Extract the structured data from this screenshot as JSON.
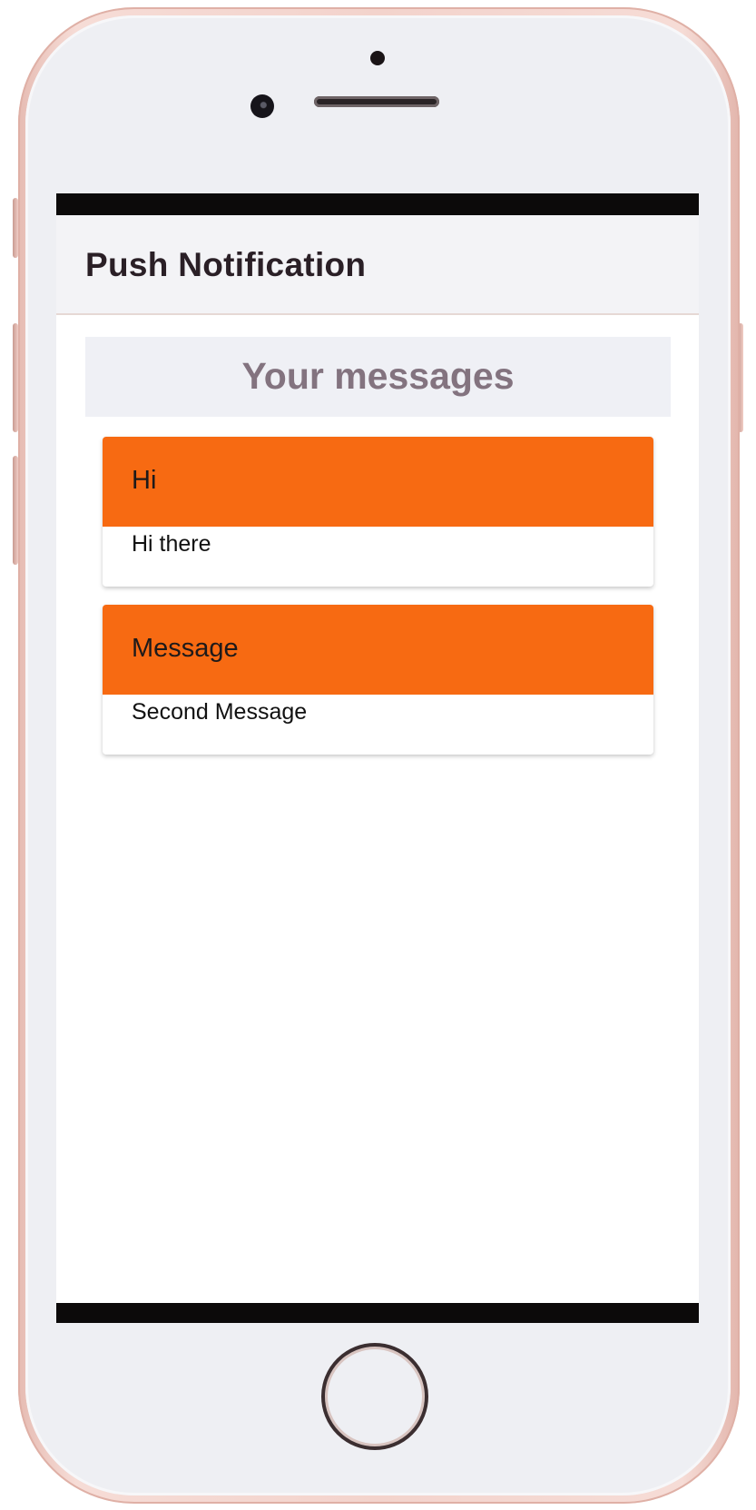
{
  "app": {
    "title": "Push Notification"
  },
  "main": {
    "heading": "Your messages",
    "messages": [
      {
        "title": "Hi",
        "body": "Hi there"
      },
      {
        "title": "Message",
        "body": "Second Message"
      }
    ]
  },
  "colors": {
    "card_header": "#f76a12",
    "heading_text": "#83737f",
    "app_bar": "#f3f3f6"
  }
}
